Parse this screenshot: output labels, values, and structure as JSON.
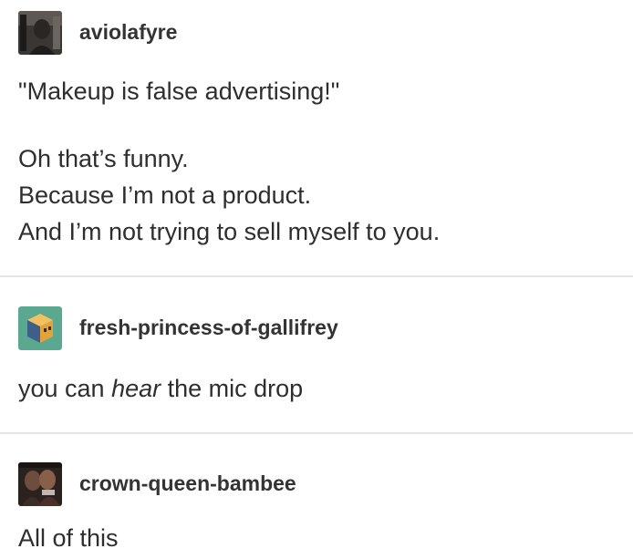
{
  "posts": [
    {
      "username": "aviolafyre",
      "avatar_icon": "dark-portrait-avatar",
      "paragraphs": [
        [
          "\"Makeup is false advertising!\""
        ],
        [
          "Oh that’s funny.",
          "Because I’m not a product.",
          "And I’m not trying to sell myself to you."
        ]
      ]
    },
    {
      "username": "fresh-princess-of-gallifrey",
      "avatar_icon": "cube-avatar",
      "text_before": "you can ",
      "text_emphasis": "hear",
      "text_after": " the mic drop"
    },
    {
      "username": "crown-queen-bambee",
      "avatar_icon": "couple-photo-avatar",
      "text": "All of this"
    }
  ],
  "colors": {
    "text": "#2e2e2e",
    "divider": "#e3e3e3",
    "cube_bg": "#5aa88f",
    "cube_face": "#e2a23c"
  }
}
